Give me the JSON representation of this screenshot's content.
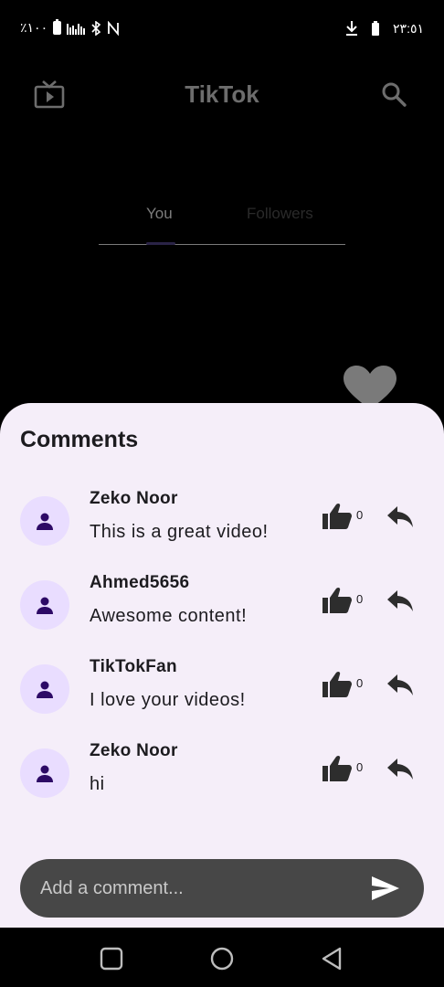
{
  "status_bar": {
    "battery_percent": "٪١٠٠",
    "time": "٢٣:٥١"
  },
  "header": {
    "title": "TikTok"
  },
  "tabs": [
    {
      "label": "You",
      "selected": true
    },
    {
      "label": "Followers",
      "selected": false
    }
  ],
  "comments_sheet": {
    "title": "Comments",
    "comments": [
      {
        "author": "Zeko Noor",
        "text": "This is a great video!",
        "likes": "0"
      },
      {
        "author": "Ahmed5656",
        "text": "Awesome content!",
        "likes": "0"
      },
      {
        "author": "TikTokFan",
        "text": "I love your videos!",
        "likes": "0"
      },
      {
        "author": "Zeko Noor",
        "text": "hi",
        "likes": "0"
      }
    ],
    "input_placeholder": "Add a comment...",
    "input_value": ""
  },
  "icons": {
    "header_left": "tv-play-icon",
    "header_right": "search-icon",
    "overlay": "heart-icon",
    "avatar": "person-icon",
    "like": "thumb-up-icon",
    "reply": "reply-icon",
    "send": "send-icon",
    "nav": [
      "recents-square-icon",
      "home-circle-icon",
      "back-triangle-icon"
    ]
  },
  "colors": {
    "sheet_background": "#f5eef9",
    "avatar_background": "#e9ddff",
    "avatar_icon": "#2d0a66",
    "composer_background": "#474747",
    "tab_indicator": "#2a2346"
  }
}
